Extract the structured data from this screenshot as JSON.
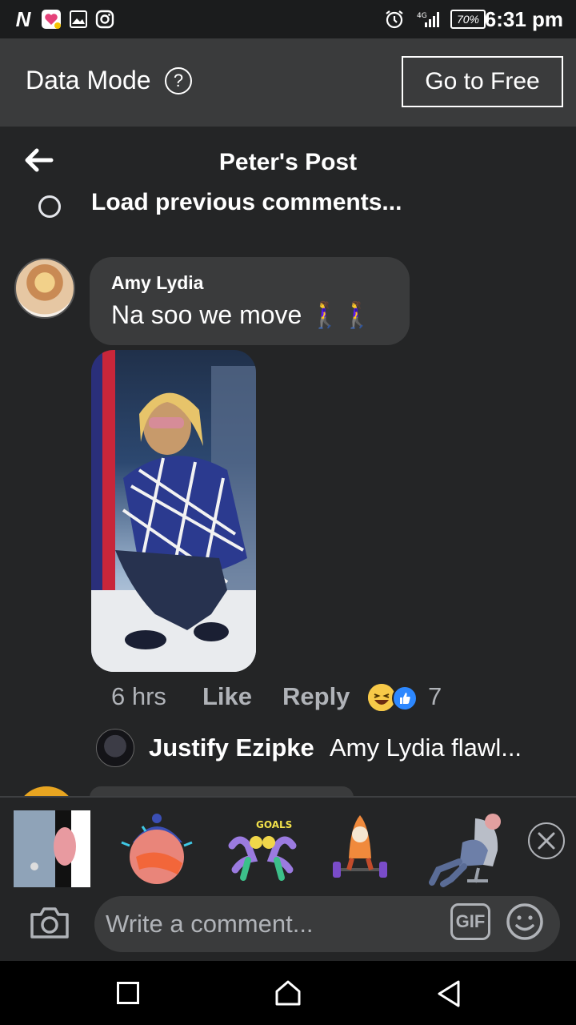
{
  "status_bar": {
    "time": "6:31 pm",
    "battery": "70%",
    "icons": [
      "n-app-icon",
      "heart-app-icon",
      "gallery-icon",
      "instagram-icon",
      "alarm-icon",
      "signal-icon",
      "battery-icon"
    ]
  },
  "data_mode": {
    "label": "Data Mode",
    "help": "?",
    "button": "Go to Free"
  },
  "header": {
    "title": "Peter's Post",
    "load_previous": "Load previous comments..."
  },
  "comment": {
    "author": "Amy Lydia",
    "text": "Na soo we move 🚶‍♀️🚶‍♀️",
    "time": "6 hrs",
    "like": "Like",
    "reply": "Reply",
    "reaction_count": "7",
    "reactions": [
      "haha",
      "like"
    ]
  },
  "reply_preview": {
    "author": "Justify Ezipke",
    "text": "Amy Lydia flawl..."
  },
  "composer": {
    "placeholder": "Write a comment...",
    "gif": "GIF",
    "stickers": [
      "door-sticker",
      "facepalm-sticker",
      "squat-goals-sticker",
      "weightlifting-sticker",
      "chair-sticker"
    ]
  },
  "colors": {
    "background": "#242526",
    "bubble": "#3a3b3c",
    "muted_text": "#b0b3b8",
    "like_blue": "#2d88ff"
  }
}
